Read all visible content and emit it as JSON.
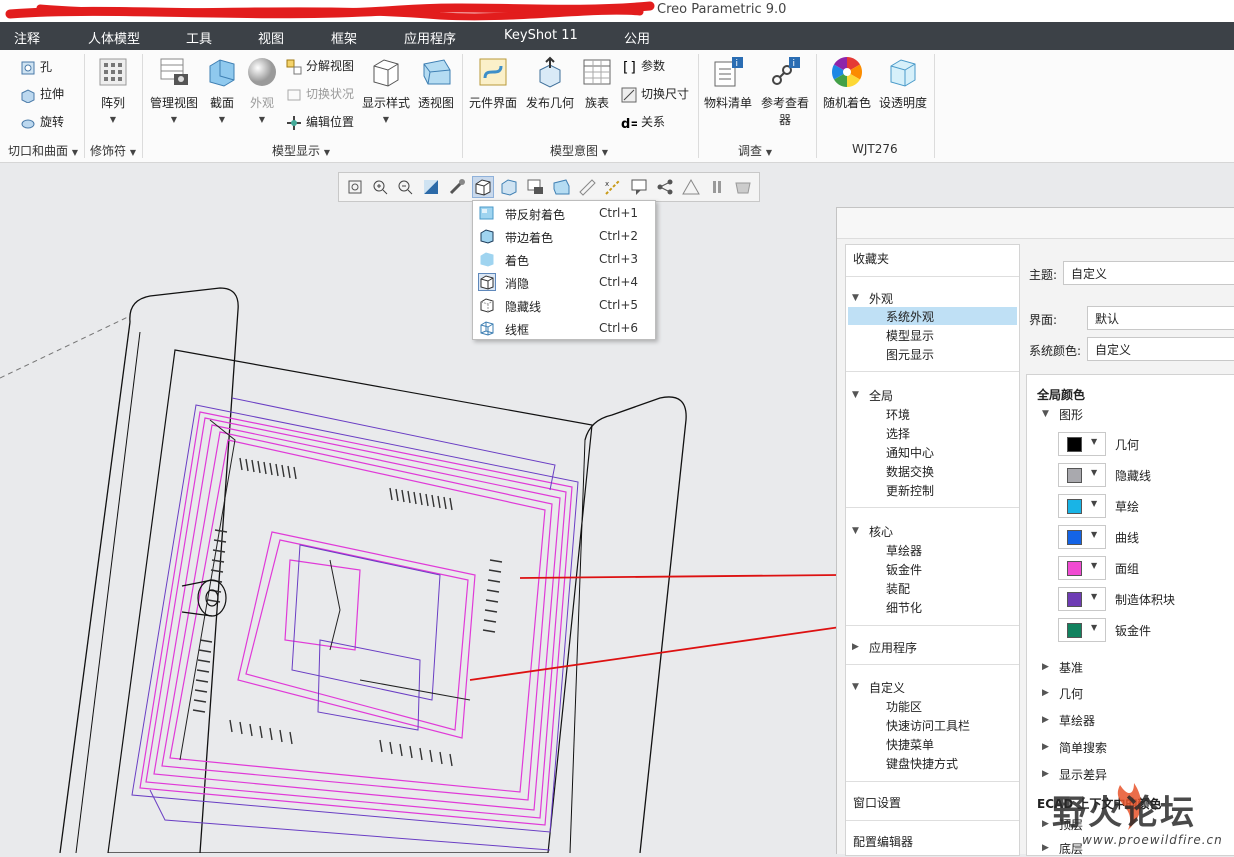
{
  "window": {
    "title": "Creo Parametric 9.0"
  },
  "menu_tabs": [
    "注释",
    "人体模型",
    "工具",
    "视图",
    "框架",
    "应用程序",
    "KeyShot 11",
    "公用"
  ],
  "ribbon": {
    "cut_surface": {
      "items": [
        "孔",
        "拉伸",
        "旋转"
      ],
      "label": "切口和曲面"
    },
    "modifier": {
      "array": "阵列",
      "label": "修饰符"
    },
    "model_display": {
      "manage_view": "管理视图",
      "section": "截面",
      "appearance": "外观",
      "explode": "分解视图",
      "toggle_state": "切换状况",
      "edit_position": "编辑位置",
      "display_style": "显示样式",
      "perspective": "透视图",
      "label": "模型显示"
    },
    "model_intent": {
      "component_interface": "元件界面",
      "publish_geometry": "发布几何",
      "family_table": "族表",
      "params": "参数",
      "toggle_dims": "切换尺寸",
      "relations": "关系",
      "label": "模型意图"
    },
    "investigate": {
      "bom": "物料清单",
      "ref_viewer_1": "参考查看",
      "ref_viewer_2": "器",
      "label": "调查"
    },
    "wjt": {
      "random_color": "随机着色",
      "set_transparency": "设透明度",
      "label": "WJT276"
    }
  },
  "display_menu": {
    "items": [
      {
        "label": "带反射着色",
        "shortcut": "Ctrl+1"
      },
      {
        "label": "带边着色",
        "shortcut": "Ctrl+2"
      },
      {
        "label": "着色",
        "shortcut": "Ctrl+3"
      },
      {
        "label": "消隐",
        "shortcut": "Ctrl+4"
      },
      {
        "label": "隐藏线",
        "shortcut": "Ctrl+5"
      },
      {
        "label": "线框",
        "shortcut": "Ctrl+6"
      }
    ]
  },
  "options_dialog": {
    "nav": {
      "favorites": "收藏夹",
      "appearance": {
        "title": "外观",
        "items": [
          "系统外观",
          "模型显示",
          "图元显示"
        ]
      },
      "global": {
        "title": "全局",
        "items": [
          "环境",
          "选择",
          "通知中心",
          "数据交换",
          "更新控制"
        ]
      },
      "core": {
        "title": "核心",
        "items": [
          "草绘器",
          "钣金件",
          "装配",
          "细节化"
        ]
      },
      "apps": "应用程序",
      "custom": {
        "title": "自定义",
        "items": [
          "功能区",
          "快速访问工具栏",
          "快捷菜单",
          "键盘快捷方式"
        ]
      },
      "window_settings": "窗口设置",
      "config_editor": "配置编辑器"
    },
    "theme_label": "主题:",
    "theme_value": "自定义",
    "ui_label": "界面:",
    "ui_value": "默认",
    "syscolor_label": "系统颜色:",
    "syscolor_value": "自定义",
    "global_colors": "全局颜色",
    "graphics": "图形",
    "swatches": [
      {
        "label": "几何",
        "color": "#000000"
      },
      {
        "label": "隐藏线",
        "color": "#a9a9ae"
      },
      {
        "label": "草绘",
        "color": "#19b4e6"
      },
      {
        "label": "曲线",
        "color": "#1464e6"
      },
      {
        "label": "面组",
        "color": "#f04bd2"
      },
      {
        "label": "制造体积块",
        "color": "#6e3cb4"
      },
      {
        "label": "钣金件",
        "color": "#12825f"
      }
    ],
    "collapsed": [
      "基准",
      "几何",
      "草绘器",
      "简单搜索",
      "显示差异"
    ],
    "ecad": "ECAD 上下文中的颜色",
    "ecad_items": [
      "顶层",
      "底层"
    ]
  },
  "watermark": {
    "name": "野火论坛",
    "url": "www.proewildfire.cn"
  },
  "colors": {
    "menubar": "#3c4147",
    "annotation_arrow": "#dd1111",
    "wire_pink": "#e03ad8",
    "wire_purple": "#6a3ec4",
    "selection": "#bfe0f5"
  }
}
